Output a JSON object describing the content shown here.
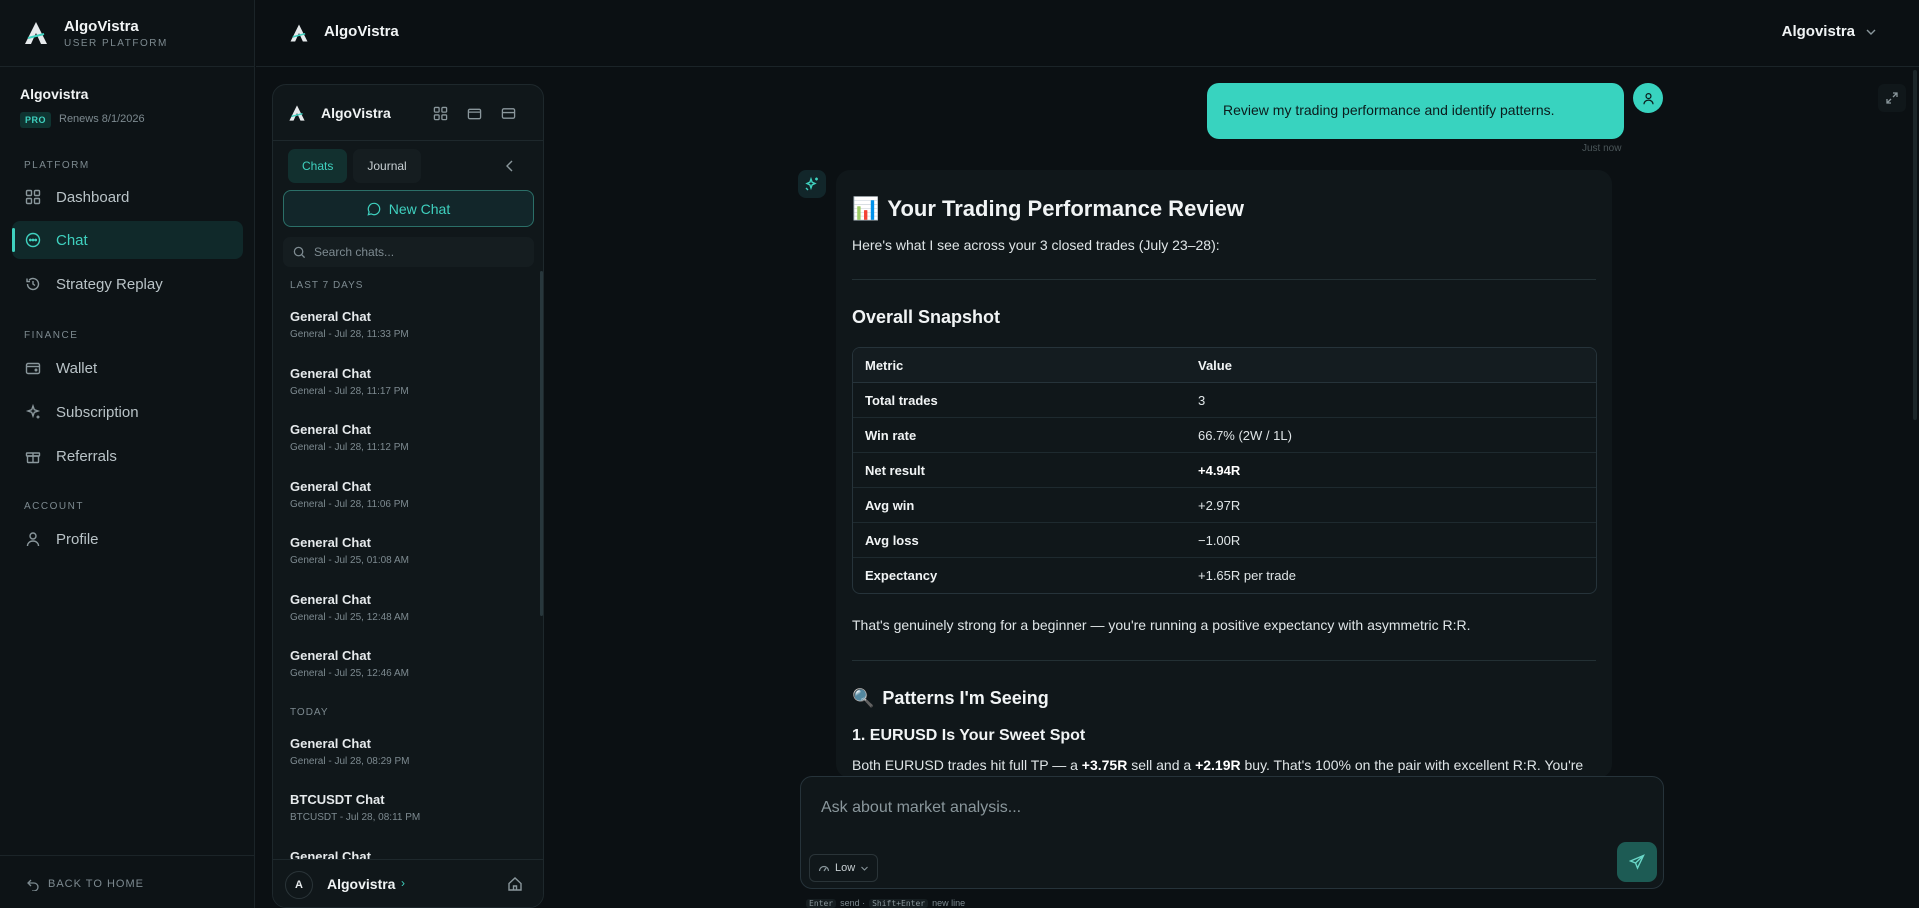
{
  "brand": {
    "name": "AlgoVistra",
    "subtitle": "USER PLATFORM"
  },
  "account": {
    "name": "Algovistra",
    "plan": "PRO",
    "renews": "Renews 8/1/2026"
  },
  "nav": {
    "platform_label": "PLATFORM",
    "finance_label": "FINANCE",
    "account_label": "ACCOUNT",
    "items": [
      {
        "label": "Dashboard",
        "icon": "grid-icon"
      },
      {
        "label": "Chat",
        "icon": "chat-icon",
        "active": true
      },
      {
        "label": "Strategy Replay",
        "icon": "replay-icon"
      },
      {
        "label": "Wallet",
        "icon": "wallet-icon"
      },
      {
        "label": "Subscription",
        "icon": "sparkle-icon"
      },
      {
        "label": "Referrals",
        "icon": "gift-icon"
      },
      {
        "label": "Profile",
        "icon": "user-icon"
      }
    ],
    "back_home": "BACK TO HOME"
  },
  "topbar": {
    "title": "AlgoVistra",
    "user": "Algovistra"
  },
  "chat_panel": {
    "title": "AlgoVistra",
    "tabs": [
      "Chats",
      "Journal"
    ],
    "new_chat": "New Chat",
    "search_placeholder": "Search chats...",
    "group_last7": "LAST 7 DAYS",
    "group_today": "TODAY",
    "last7": [
      {
        "title": "General Chat",
        "sub": "General - Jul 28, 11:33 PM"
      },
      {
        "title": "General Chat",
        "sub": "General - Jul 28, 11:17 PM"
      },
      {
        "title": "General Chat",
        "sub": "General - Jul 28, 11:12 PM"
      },
      {
        "title": "General Chat",
        "sub": "General - Jul 28, 11:06 PM"
      },
      {
        "title": "General Chat",
        "sub": "General - Jul 25, 01:08 AM"
      },
      {
        "title": "General Chat",
        "sub": "General - Jul 25, 12:48 AM"
      },
      {
        "title": "General Chat",
        "sub": "General - Jul 25, 12:46 AM"
      }
    ],
    "today": [
      {
        "title": "General Chat",
        "sub": "General - Jul 28, 08:29 PM"
      },
      {
        "title": "BTCUSDT Chat",
        "sub": "BTCUSDT - Jul 28, 08:11 PM"
      },
      {
        "title": "General Chat",
        "sub": ""
      }
    ],
    "footer_initial": "A",
    "footer_name": "Algovistra"
  },
  "conversation": {
    "user_message": "Review my trading performance and identify patterns.",
    "timestamp": "Just now",
    "h1_emoji": "📊",
    "h1": "Your Trading Performance Review",
    "intro": "Here's what I see across your 3 closed trades (July 23–28):",
    "h2_snapshot": "Overall Snapshot",
    "table_headers": [
      "Metric",
      "Value"
    ],
    "table_rows": [
      [
        "Total trades",
        "3"
      ],
      [
        "Win rate",
        "66.7% (2W / 1L)"
      ],
      [
        "Net result",
        "+4.94R"
      ],
      [
        "Avg win",
        "+2.97R"
      ],
      [
        "Avg loss",
        "−1.00R"
      ],
      [
        "Expectancy",
        "+1.65R per trade"
      ]
    ],
    "summary": "That's genuinely strong for a beginner — you're running a positive expectancy with asymmetric R:R.",
    "h2_patterns_emoji": "🔍",
    "h2_patterns": "Patterns I'm Seeing",
    "h3_eurusd": "1. EURUSD Is Your Sweet Spot",
    "p_eurusd_1": "Both EURUSD trades hit full TP — a ",
    "p_eurusd_b1": "+3.75R",
    "p_eurusd_2": " sell and a ",
    "p_eurusd_b2": "+2.19R",
    "p_eurusd_3": " buy. That's 100% on the pair with excellent R:R. You're"
  },
  "composer": {
    "placeholder": "Ask about market analysis...",
    "effort": "Low",
    "hint_enter": "Enter",
    "hint_send": "send ·",
    "hint_shift": "Shift+Enter",
    "hint_newline": "new line"
  }
}
